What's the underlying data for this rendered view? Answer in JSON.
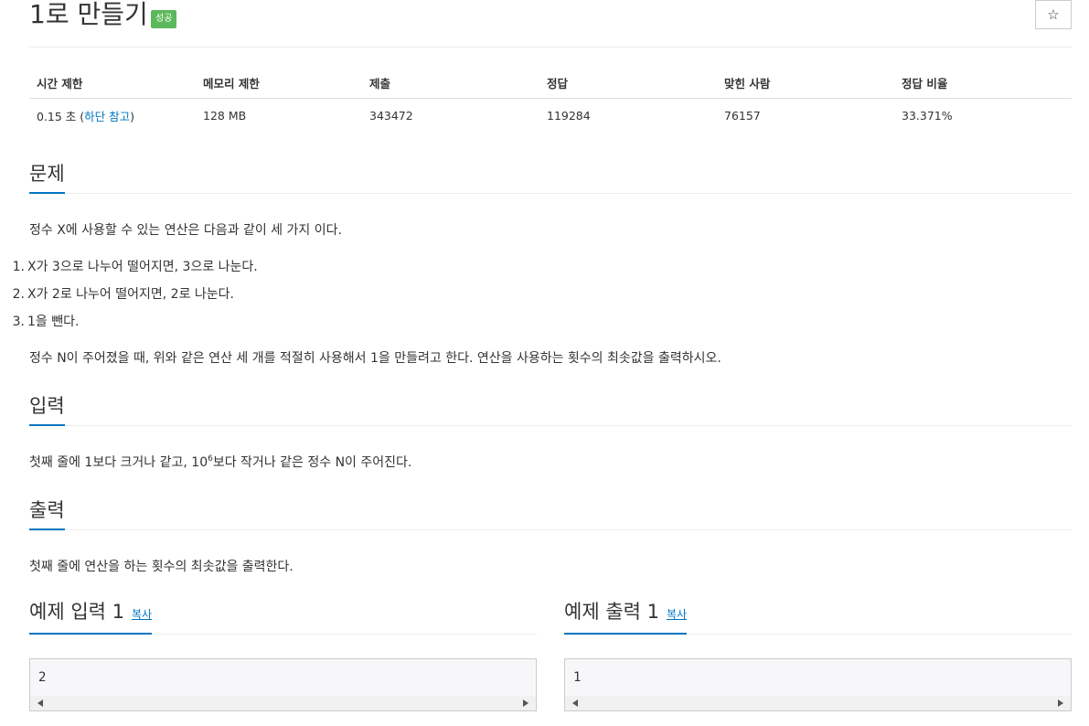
{
  "header": {
    "title": "1로 만들기",
    "badge": "성공",
    "star_icon": "☆"
  },
  "info_table": {
    "headers": [
      "시간 제한",
      "메모리 제한",
      "제출",
      "정답",
      "맞힌 사람",
      "정답 비율"
    ],
    "time_limit_prefix": "0.15 초 (",
    "time_limit_link": "하단 참고",
    "time_limit_suffix": ")",
    "memory_limit": "128 MB",
    "submissions": "343472",
    "accepted": "119284",
    "solvers": "76157",
    "ratio": "33.371%"
  },
  "problem": {
    "heading": "문제",
    "intro": "정수 X에 사용할 수 있는 연산은 다음과 같이 세 가지 이다.",
    "items": [
      {
        "num": "1.",
        "text": "X가 3으로 나누어 떨어지면, 3으로 나눈다."
      },
      {
        "num": "2.",
        "text": "X가 2로 나누어 떨어지면, 2로 나눈다."
      },
      {
        "num": "3.",
        "text": "1을 뺀다."
      }
    ],
    "outro": "정수 N이 주어졌을 때, 위와 같은 연산 세 개를 적절히 사용해서 1을 만들려고 한다. 연산을 사용하는 횟수의 최솟값을 출력하시오."
  },
  "input": {
    "heading": "입력",
    "text_before": "첫째 줄에 1보다 크거나 같고, 10",
    "sup": "6",
    "text_after": "보다 작거나 같은 정수 N이 주어진다."
  },
  "output": {
    "heading": "출력",
    "text": "첫째 줄에 연산을 하는 횟수의 최솟값을 출력한다."
  },
  "samples": {
    "input_heading": "예제 입력 1",
    "output_heading": "예제 출력 1",
    "copy_label": "복사",
    "input_value": "2",
    "output_value": "1"
  }
}
